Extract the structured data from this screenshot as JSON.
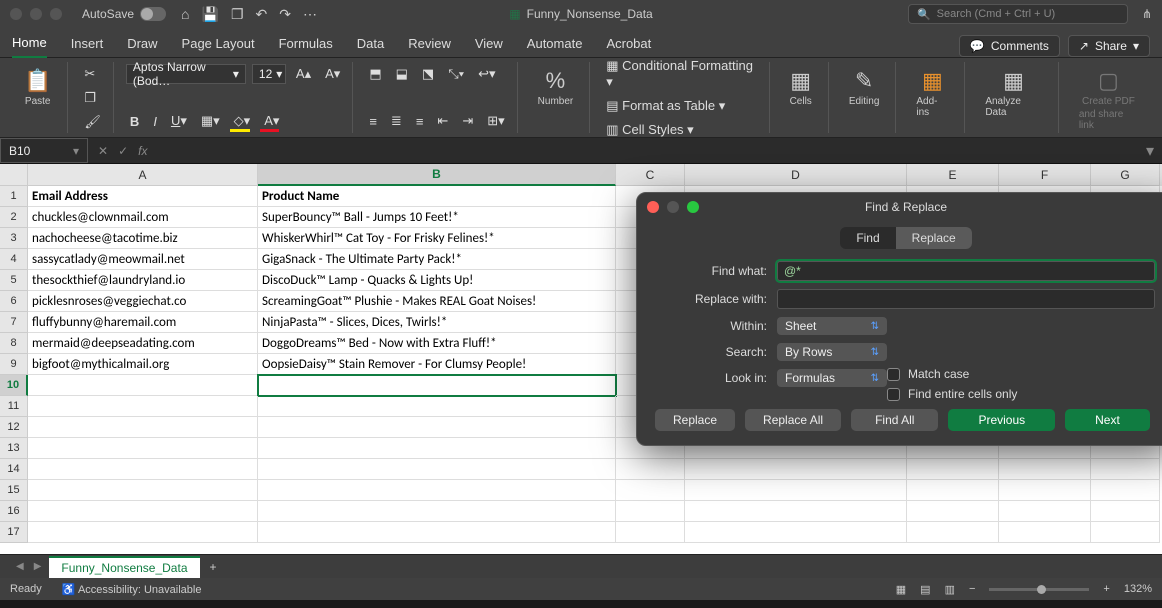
{
  "titlebar": {
    "autosave": "AutoSave",
    "doc_name": "Funny_Nonsense_Data",
    "search_placeholder": "Search (Cmd + Ctrl + U)"
  },
  "tabs": [
    "Home",
    "Insert",
    "Draw",
    "Page Layout",
    "Formulas",
    "Data",
    "Review",
    "View",
    "Automate",
    "Acrobat"
  ],
  "tab_active": "Home",
  "right_actions": {
    "comments": "Comments",
    "share": "Share"
  },
  "ribbon": {
    "paste": "Paste",
    "font_name": "Aptos Narrow (Bod…",
    "font_size": "12",
    "number": "Number",
    "cond": "Conditional Formatting",
    "table": "Format as Table",
    "styles": "Cell Styles",
    "cells": "Cells",
    "editing": "Editing",
    "addins": "Add-ins",
    "analyze": "Analyze Data",
    "pdf1": "Create PDF",
    "pdf2": "and share link"
  },
  "namebox": "B10",
  "columns": [
    "A",
    "B",
    "C",
    "D",
    "E",
    "F",
    "G"
  ],
  "col_widths": [
    "wA",
    "wB",
    "wC",
    "wD",
    "wE",
    "wF",
    "wG"
  ],
  "rows": [
    {
      "n": 1,
      "a": "Email Address",
      "b": "Product Name",
      "bold": true
    },
    {
      "n": 2,
      "a": "chuckles@clownmail.com",
      "b": "SuperBouncy™ Ball - Jumps 10 Feet!*"
    },
    {
      "n": 3,
      "a": "nachocheese@tacotime.biz",
      "b": "WhiskerWhirl™ Cat Toy - For Frisky Felines!*"
    },
    {
      "n": 4,
      "a": "sassycatlady@meowmail.net",
      "b": "GigaSnack - The Ultimate Party Pack!*"
    },
    {
      "n": 5,
      "a": "thesockthief@laundryland.io",
      "b": "DiscoDuck™ Lamp - Quacks & Lights Up!"
    },
    {
      "n": 6,
      "a": "picklesnroses@veggiechat.co",
      "b": "ScreamingGoat™ Plushie - Makes REAL Goat Noises!"
    },
    {
      "n": 7,
      "a": "fluffybunny@haremail.com",
      "b": "NinjaPasta™ - Slices, Dices, Twirls!*"
    },
    {
      "n": 8,
      "a": "mermaid@deepseadating.com",
      "b": "DoggoDreams™ Bed - Now with Extra Fluff!*"
    },
    {
      "n": 9,
      "a": "bigfoot@mythicalmail.org",
      "b": "OopsieDaisy™ Stain Remover - For Clumsy People!"
    },
    {
      "n": 10,
      "a": "",
      "b": "",
      "active": true
    },
    {
      "n": 11,
      "a": "",
      "b": ""
    },
    {
      "n": 12,
      "a": "",
      "b": ""
    },
    {
      "n": 13,
      "a": "",
      "b": ""
    },
    {
      "n": 14,
      "a": "",
      "b": ""
    },
    {
      "n": 15,
      "a": "",
      "b": ""
    },
    {
      "n": 16,
      "a": "",
      "b": ""
    },
    {
      "n": 17,
      "a": "",
      "b": ""
    }
  ],
  "sheet_tab": "Funny_Nonsense_Data",
  "statusbar": {
    "ready": "Ready",
    "acc": "Accessibility: Unavailable",
    "zoom": "132%"
  },
  "modal": {
    "title": "Find & Replace",
    "tabs": [
      "Find",
      "Replace"
    ],
    "find_label": "Find what:",
    "find_value": "@*",
    "replace_label": "Replace with:",
    "replace_value": "",
    "within_label": "Within:",
    "within_value": "Sheet",
    "search_label": "Search:",
    "search_value": "By Rows",
    "lookin_label": "Look in:",
    "lookin_value": "Formulas",
    "match_case": "Match case",
    "entire": "Find entire cells only",
    "btn_replace": "Replace",
    "btn_replace_all": "Replace All",
    "btn_find_all": "Find All",
    "btn_prev": "Previous",
    "btn_next": "Next"
  }
}
